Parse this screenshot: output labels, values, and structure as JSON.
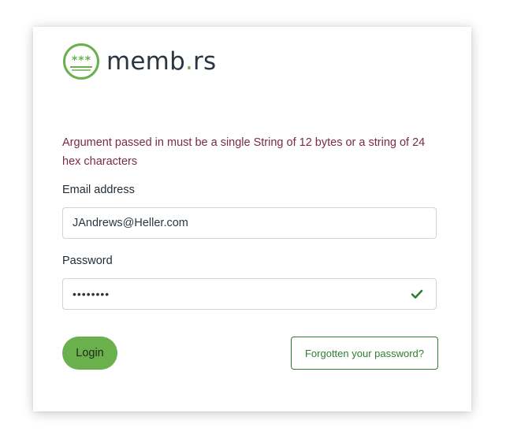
{
  "brand": {
    "name_main": "memb",
    "name_dot": ".",
    "name_tail": "rs",
    "logo_icon": "asterisk-badge-icon",
    "logo_glyphs": "***",
    "accent_color": "#6ab04c"
  },
  "error_message": "Argument passed in must be a single String of 12 bytes or a string of 24 hex characters",
  "form": {
    "email_label": "Email address",
    "email_value": "JAndrews@Heller.com",
    "password_label": "Password",
    "password_value": "••••••••",
    "password_valid_icon": "checkmark-icon"
  },
  "actions": {
    "login_label": "Login",
    "forgot_label": "Forgotten your password?"
  }
}
